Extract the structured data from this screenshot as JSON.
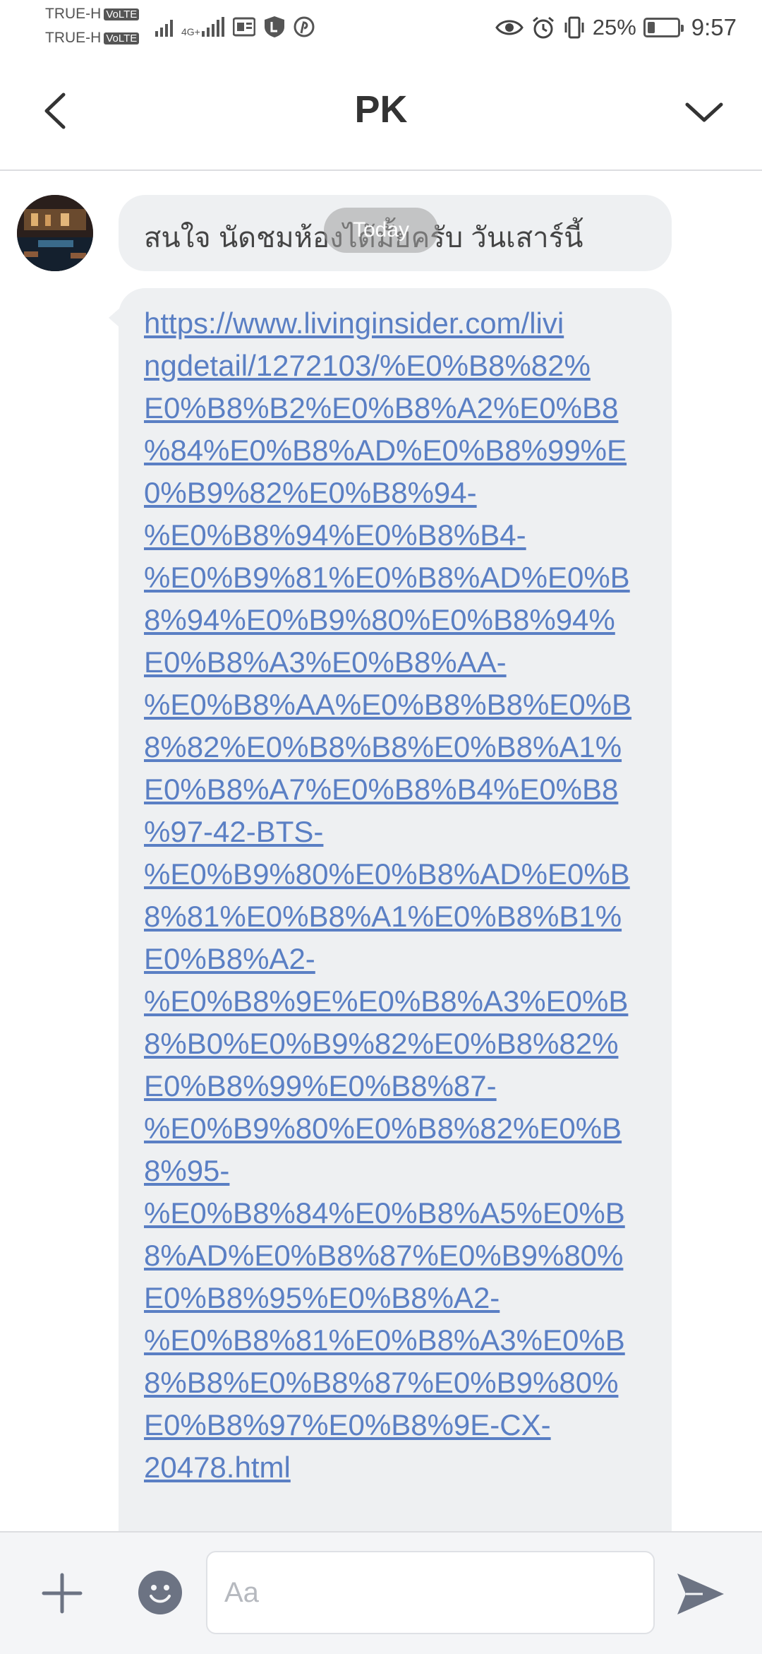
{
  "status_bar": {
    "carrier1": "TRUE-H",
    "carrier2": "TRUE-H",
    "volte": "VoLTE",
    "network": "4G+",
    "battery_percent": "25%",
    "battery_level": 0.25,
    "time": "9:57",
    "icons_left": [
      "signal-icon",
      "signal-4g-icon",
      "app-notification-icon",
      "line-icon",
      "pinterest-icon"
    ],
    "icons_right": [
      "eye-icon",
      "alarm-icon",
      "vibrate-icon",
      "battery-icon"
    ]
  },
  "header": {
    "title": "PK"
  },
  "chat": {
    "date_badge": "Today",
    "messages": [
      {
        "text": "สนใจ นัดชมห้องได้มั้ยครับ วันเสาร์นี้"
      },
      {
        "link": "https://www.livinginsider.com/livi\nngdetail/1272103/%E0%B8%82%\nE0%B8%B2%E0%B8%A2%E0%B8\n%84%E0%B8%AD%E0%B8%99%E\n0%B9%82%E0%B8%94-\n%E0%B8%94%E0%B8%B4-\n%E0%B9%81%E0%B8%AD%E0%B\n8%94%E0%B9%80%E0%B8%94%\nE0%B8%A3%E0%B8%AA-\n%E0%B8%AA%E0%B8%B8%E0%B\n8%82%E0%B8%B8%E0%B8%A1%\nE0%B8%A7%E0%B8%B4%E0%B8\n%97-42-BTS-\n%E0%B9%80%E0%B8%AD%E0%B\n8%81%E0%B8%A1%E0%B8%B1%\nE0%B8%A2-\n%E0%B8%9E%E0%B8%A3%E0%B\n8%B0%E0%B9%82%E0%B8%82%\nE0%B8%99%E0%B8%87-\n%E0%B9%80%E0%B8%82%E0%B\n8%95-\n%E0%B8%84%E0%B8%A5%E0%B\n8%AD%E0%B8%87%E0%B9%80%\nE0%B8%95%E0%B8%A2-\n%E0%B8%81%E0%B8%A3%E0%B\n8%B8%E0%B8%87%E0%B9%80%\nE0%B8%97%E0%B8%9E-CX-\n20478.html"
      }
    ]
  },
  "composer": {
    "placeholder": "Aa"
  }
}
